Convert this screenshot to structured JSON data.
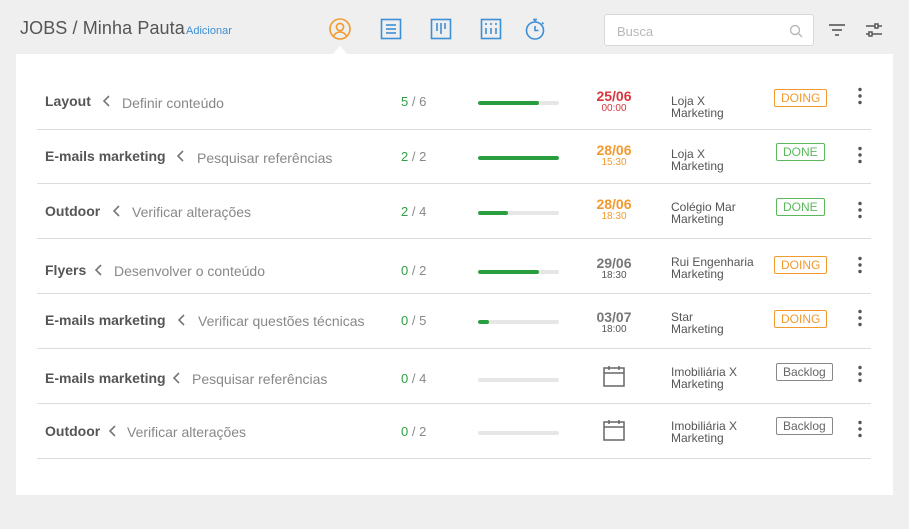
{
  "header": {
    "title": "JOBS / Minha Pauta",
    "add_label": "Adicionar",
    "nav_icons": [
      "user-circle-icon",
      "list-icon",
      "board-columns-icon",
      "calendar-grid-icon",
      "stopwatch-icon"
    ],
    "active_nav": "user-circle-icon",
    "search_placeholder": "Busca",
    "search_value": "",
    "tools": [
      "filter-icon",
      "sliders-icon"
    ]
  },
  "colors": {
    "accent_orange": "#f29a2e",
    "nav_blue": "#3d8fd6",
    "progress_green": "#2a9d3f",
    "date_overdue": "#d9363e",
    "date_soon": "#f29a2e",
    "doing": "#f29a2e",
    "done": "#5cb85c",
    "backlog": "#777777"
  },
  "rows": [
    {
      "job": "Layout",
      "task": "Definir conteúdo",
      "done": "5",
      "sep": " / ",
      "total": "6",
      "progress": 0.75,
      "date": "25/06",
      "time": "00:00",
      "date_status": "overdue",
      "client1": "Loja X",
      "client2": "Marketing",
      "status": "DOING"
    },
    {
      "job": "E-mails marketing",
      "task": "Pesquisar referências",
      "done": "2",
      "sep": " / ",
      "total": "2",
      "progress": 1.0,
      "date": "28/06",
      "time": "15:30",
      "date_status": "soon",
      "client1": "Loja X",
      "client2": "Marketing",
      "status": "DONE"
    },
    {
      "job": "Outdoor",
      "task": "Verificar alterações",
      "done": "2",
      "sep": " / ",
      "total": "4",
      "progress": 0.375,
      "date": "28/06",
      "time": "18:30",
      "date_status": "soon",
      "client1": "Colégio Mar",
      "client2": "Marketing",
      "status": "DONE"
    },
    {
      "job": "Flyers",
      "task": "Desenvolver o conteúdo",
      "done": "0",
      "sep": " / ",
      "total": "2",
      "progress": 0.75,
      "date": "29/06",
      "time": "18:30",
      "date_status": "normal",
      "client1": "Rui Engenharia",
      "client2": "Marketing",
      "status": "DOING"
    },
    {
      "job": "E-mails marketing",
      "task": "Verificar questões técnicas",
      "done": "0",
      "sep": " / ",
      "total": "5",
      "progress": 0.14,
      "date": "03/07",
      "time": "18:00",
      "date_status": "normal",
      "client1": "Star",
      "client2": "Marketing",
      "status": "DOING"
    },
    {
      "job": "E-mails marketing",
      "task": "Pesquisar referências",
      "done": "0",
      "sep": " / ",
      "total": "4",
      "progress": 0,
      "date": "",
      "time": "",
      "date_status": "none",
      "client1": "Imobiliária X",
      "client2": "Marketing",
      "status": "Backlog"
    },
    {
      "job": "Outdoor",
      "task": "Verificar alterações",
      "done": "0",
      "sep": " / ",
      "total": "2",
      "progress": 0,
      "date": "",
      "time": "",
      "date_status": "none",
      "client1": "Imobiliária X",
      "client2": "Marketing",
      "status": "Backlog"
    }
  ]
}
